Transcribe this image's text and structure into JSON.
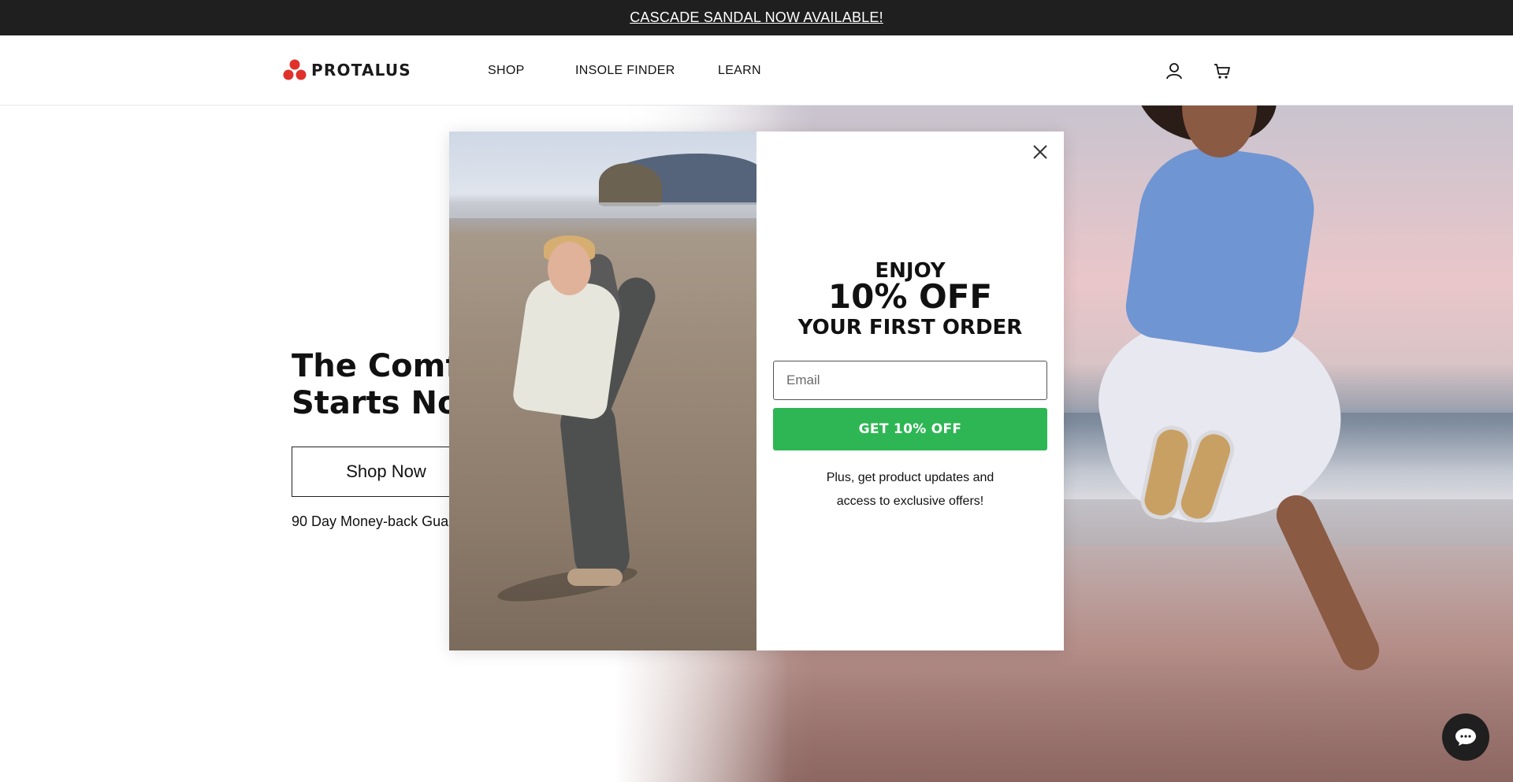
{
  "announcement": {
    "text": "CASCADE SANDAL NOW AVAILABLE!"
  },
  "header": {
    "logo_text": "PROTALUS",
    "nav": [
      {
        "label": "SHOP"
      },
      {
        "label": "INSOLE FINDER"
      },
      {
        "label": "LEARN"
      }
    ],
    "icons": [
      "account-icon",
      "cart-icon"
    ]
  },
  "hero": {
    "title_line1": "The Comfort",
    "title_line2": "Starts Now",
    "button_label": "Shop Now",
    "guarantee": "90 Day Money-back Guarantee"
  },
  "popup": {
    "line1": "ENJOY",
    "line2": "10% OFF",
    "line3": "YOUR FIRST ORDER",
    "email_placeholder": "Email",
    "email_value": "",
    "cta_label": "GET 10% OFF",
    "fine_line1": "Plus, get product updates and",
    "fine_line2": "access to exclusive offers!"
  },
  "colors": {
    "announcement_bg": "#1f1f1f",
    "brand_red": "#e0312b",
    "cta_green": "#2eb654",
    "chat_bg": "#1f1f1f"
  }
}
